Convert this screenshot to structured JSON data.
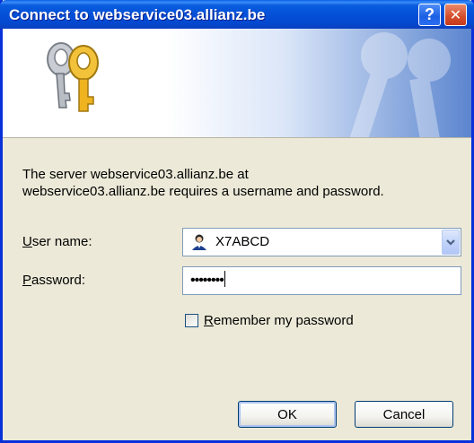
{
  "window": {
    "title": "Connect to webservice03.allianz.be",
    "help_glyph": "?",
    "close_glyph": "✕"
  },
  "message": {
    "line1": "The server webservice03.allianz.be at",
    "line2": "webservice03.allianz.be requires a username and password."
  },
  "form": {
    "username_label_access": "U",
    "username_label_rest": "ser name:",
    "username_value": "X7ABCD",
    "password_label_access": "P",
    "password_label_rest": "assword:",
    "password_mask": "••••••••",
    "remember_access": "R",
    "remember_rest": "emember my password",
    "remember_checked": false
  },
  "buttons": {
    "ok": "OK",
    "cancel": "Cancel"
  },
  "colors": {
    "titlebar": "#0450d8",
    "window_bg": "#ece9d8",
    "field_border": "#7f9db9"
  }
}
